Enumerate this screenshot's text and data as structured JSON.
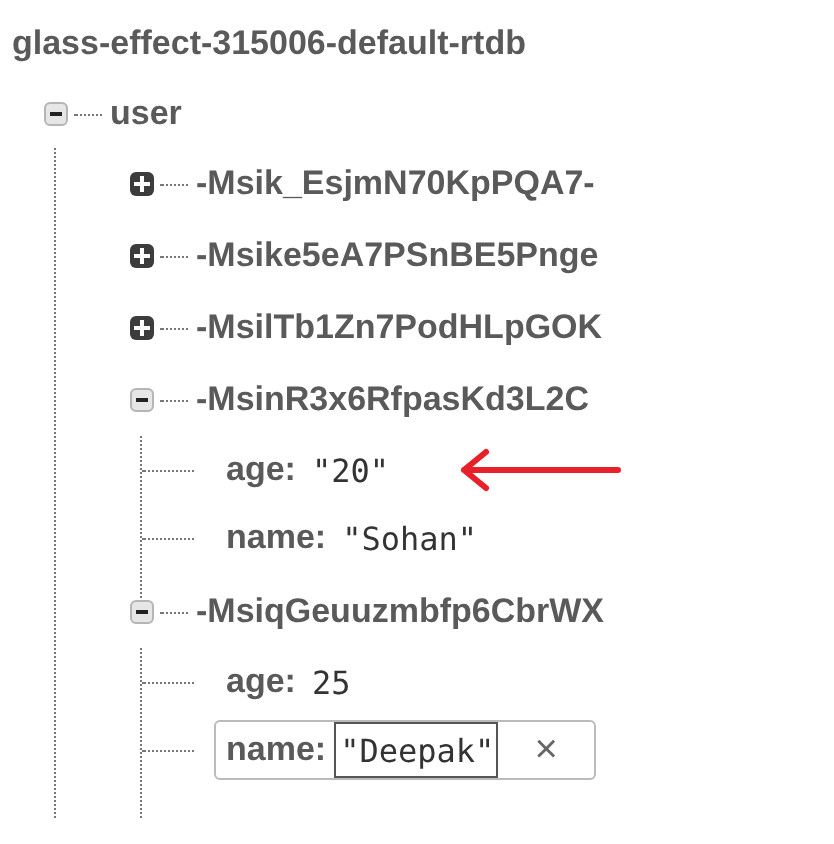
{
  "database": "glass-effect-315006-default-rtdb",
  "root": {
    "key": "user",
    "expanded": true,
    "children": [
      {
        "key": "-Msik_EsjmN70KpPQA7-",
        "expanded": false
      },
      {
        "key": "-Msike5eA7PSnBE5Pnge",
        "expanded": false
      },
      {
        "key": "-MsilTb1Zn7PodHLpGOK",
        "expanded": false
      },
      {
        "key": "-MsinR3x6RfpasKd3L2C",
        "expanded": true,
        "children": [
          {
            "kind": "leaf",
            "key": "age:",
            "value": "\"20\"",
            "arrow": true
          },
          {
            "kind": "leaf",
            "key": "name:",
            "value": "\"Sohan\""
          }
        ]
      },
      {
        "key": "-MsiqGeuuzmbfp6CbrWX",
        "expanded": true,
        "children": [
          {
            "kind": "leaf",
            "key": "age:",
            "value": "25"
          },
          {
            "kind": "edit",
            "key": "name:",
            "value": "\"Deepak\"",
            "clear": "×"
          }
        ]
      }
    ]
  }
}
